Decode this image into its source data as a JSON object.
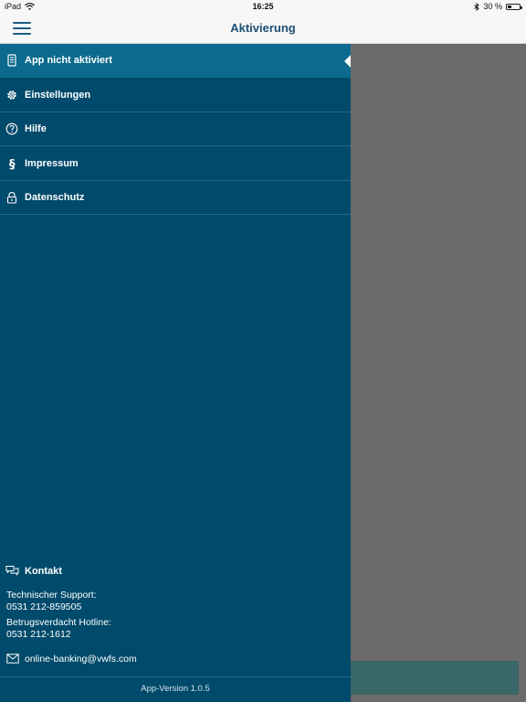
{
  "statusbar": {
    "device": "iPad",
    "time": "16:25",
    "battery_text": "30 %",
    "battery_level": 0.3
  },
  "navbar": {
    "title": "Aktivierung"
  },
  "menu": {
    "items": [
      {
        "label": "App nicht aktiviert",
        "icon": "device-icon",
        "active": true
      },
      {
        "label": "Einstellungen",
        "icon": "gear-icon",
        "active": false
      },
      {
        "label": "Hilfe",
        "icon": "help-icon",
        "active": false
      },
      {
        "label": "Impressum",
        "icon": "paragraph-icon",
        "active": false
      },
      {
        "label": "Datenschutz",
        "icon": "lock-icon",
        "active": false
      }
    ]
  },
  "contact": {
    "title": "Kontakt",
    "support_label": "Technischer Support:",
    "support_phone": "0531 212-859505",
    "hotline_label": "Betrugsverdacht Hotline:",
    "hotline_phone": "0531 212-1612",
    "email": "online-banking@vwfs.com"
  },
  "footer": {
    "version": "App-Version 1.0.5"
  },
  "colors": {
    "drawer": "#004a6b",
    "active_item": "#0b6a8e",
    "overlay": "#6b6b6b",
    "title": "#1d4f73"
  }
}
